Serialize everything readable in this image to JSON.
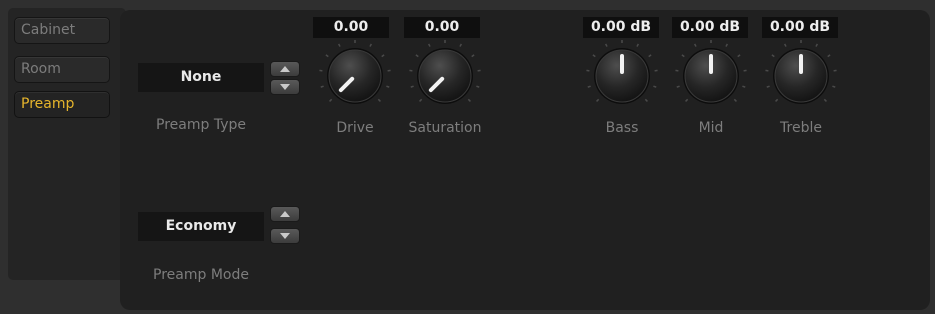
{
  "sidebar": {
    "tabs": [
      {
        "label": "Cabinet"
      },
      {
        "label": "Room"
      },
      {
        "label": "Preamp"
      }
    ],
    "active_tab": "Preamp"
  },
  "preamp": {
    "type": {
      "value": "None",
      "label": "Preamp Type"
    },
    "mode": {
      "value": "Economy",
      "label": "Preamp Mode"
    }
  },
  "knobs": [
    {
      "label": "Drive",
      "value": "0.00",
      "rotation_deg": -135
    },
    {
      "label": "Saturation",
      "value": "0.00",
      "rotation_deg": -135
    },
    {
      "label": "Bass",
      "value": "0.00 dB",
      "rotation_deg": 0
    },
    {
      "label": "Mid",
      "value": "0.00 dB",
      "rotation_deg": 0
    },
    {
      "label": "Treble",
      "value": "0.00 dB",
      "rotation_deg": 0
    }
  ],
  "colors": {
    "active_tab": "#e6b52c",
    "label": "#7d7d7d",
    "value_text": "#ededed"
  },
  "icons": {
    "spin_up": "triangle-up-icon",
    "spin_down": "triangle-down-icon"
  }
}
